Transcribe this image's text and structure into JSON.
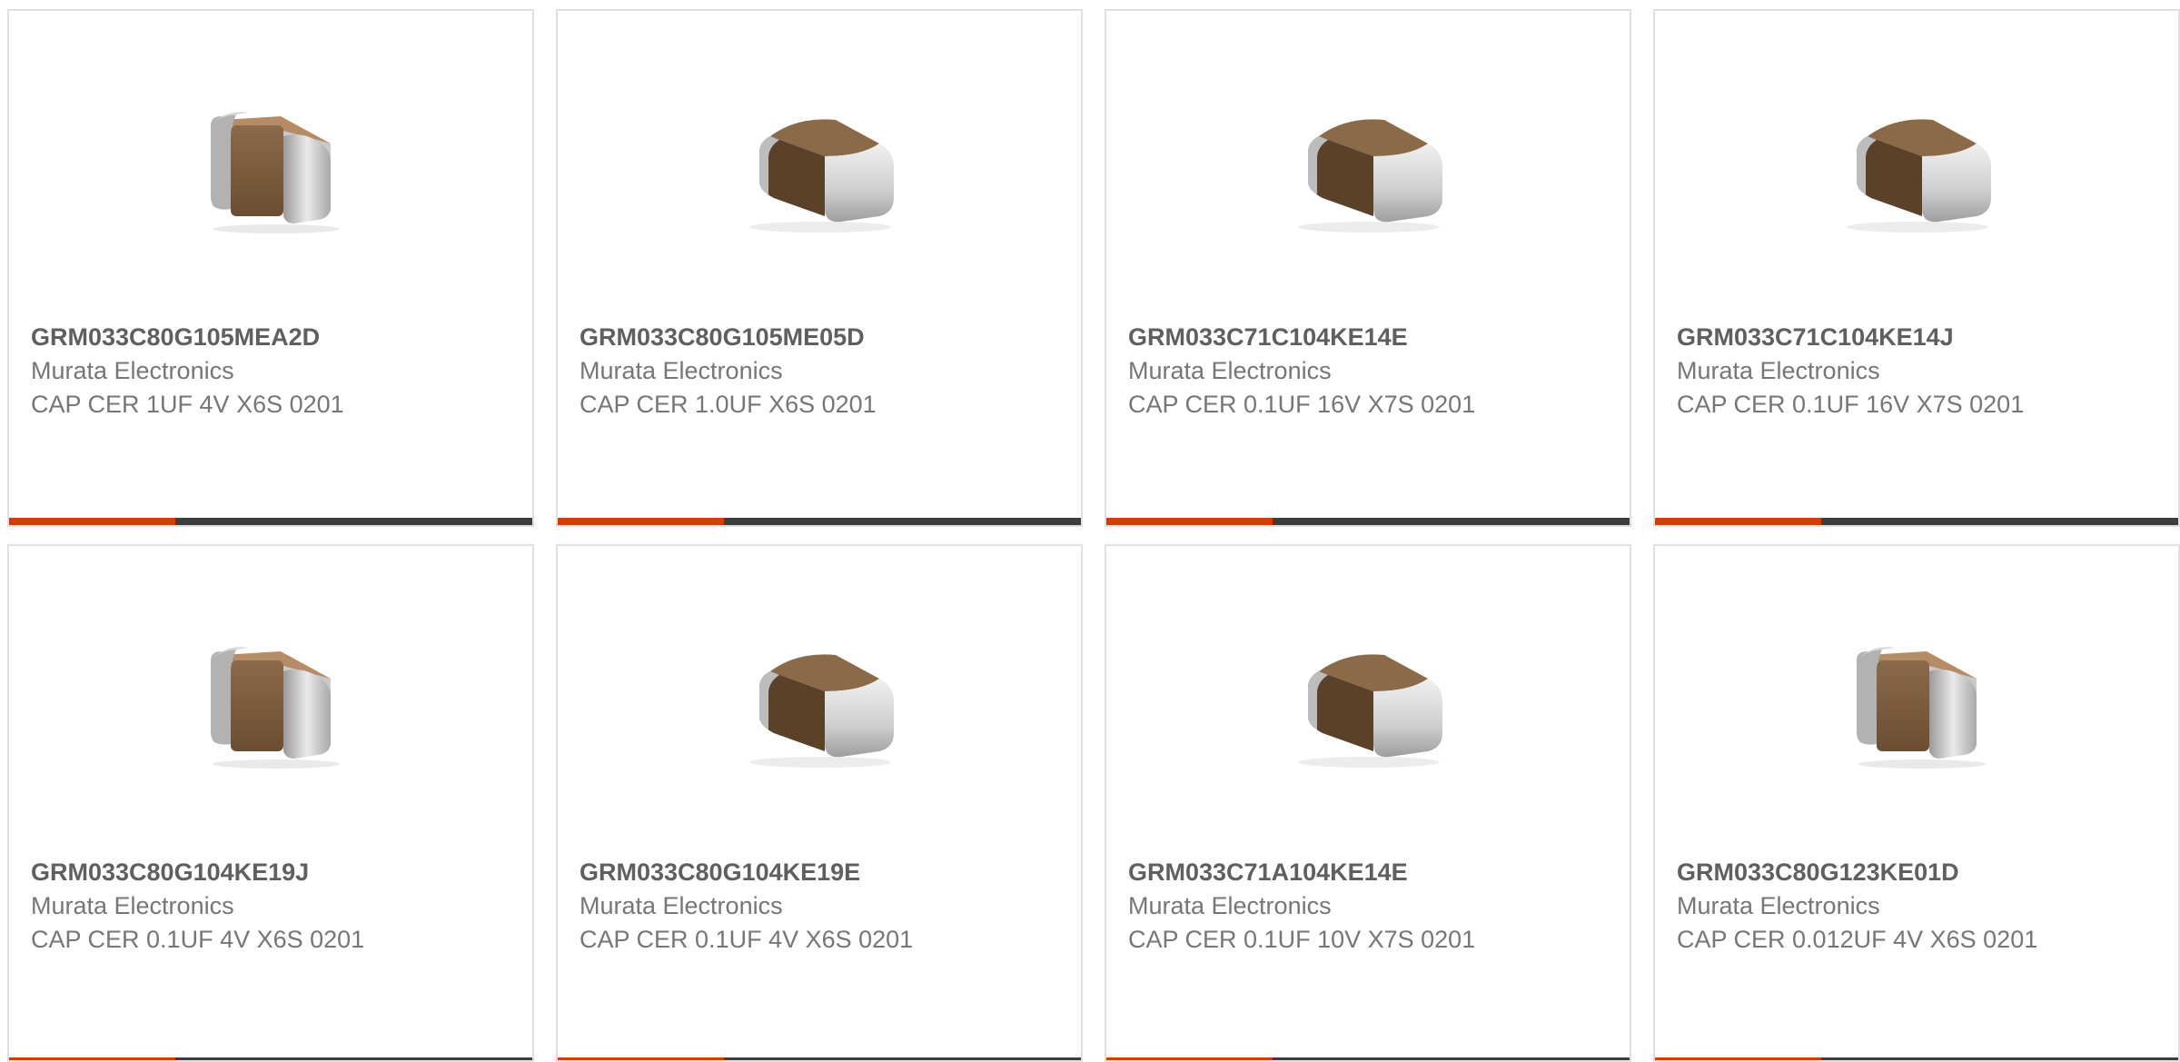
{
  "theme": {
    "accent": "#d83b01",
    "bar": "#3d3d3d",
    "border": "#e0e0e0",
    "body_brown": "#8b6a4a",
    "terminal_grey": "#c9c9c9"
  },
  "products": [
    {
      "part_number": "GRM033C80G105MEA2D",
      "manufacturer": "Murata Electronics",
      "description": "CAP CER 1UF 4V X6S 0201",
      "image_icon": "capacitor-chip-upright-icon"
    },
    {
      "part_number": "GRM033C80G105ME05D",
      "manufacturer": "Murata Electronics",
      "description": "CAP CER 1.0UF X6S 0201",
      "image_icon": "capacitor-chip-flat-icon"
    },
    {
      "part_number": "GRM033C71C104KE14E",
      "manufacturer": "Murata Electronics",
      "description": "CAP CER 0.1UF 16V X7S 0201",
      "image_icon": "capacitor-chip-flat-icon"
    },
    {
      "part_number": "GRM033C71C104KE14J",
      "manufacturer": "Murata Electronics",
      "description": "CAP CER 0.1UF 16V X7S 0201",
      "image_icon": "capacitor-chip-flat-icon"
    },
    {
      "part_number": "GRM033C80G104KE19J",
      "manufacturer": "Murata Electronics",
      "description": "CAP CER 0.1UF 4V X6S 0201",
      "image_icon": "capacitor-chip-upright-icon"
    },
    {
      "part_number": "GRM033C80G104KE19E",
      "manufacturer": "Murata Electronics",
      "description": "CAP CER 0.1UF 4V X6S 0201",
      "image_icon": "capacitor-chip-flat-icon"
    },
    {
      "part_number": "GRM033C71A104KE14E",
      "manufacturer": "Murata Electronics",
      "description": "CAP CER 0.1UF 10V X7S 0201",
      "image_icon": "capacitor-chip-flat-icon"
    },
    {
      "part_number": "GRM033C80G123KE01D",
      "manufacturer": "Murata Electronics",
      "description": "CAP CER 0.012UF 4V X6S 0201",
      "image_icon": "capacitor-chip-upright-icon"
    }
  ]
}
